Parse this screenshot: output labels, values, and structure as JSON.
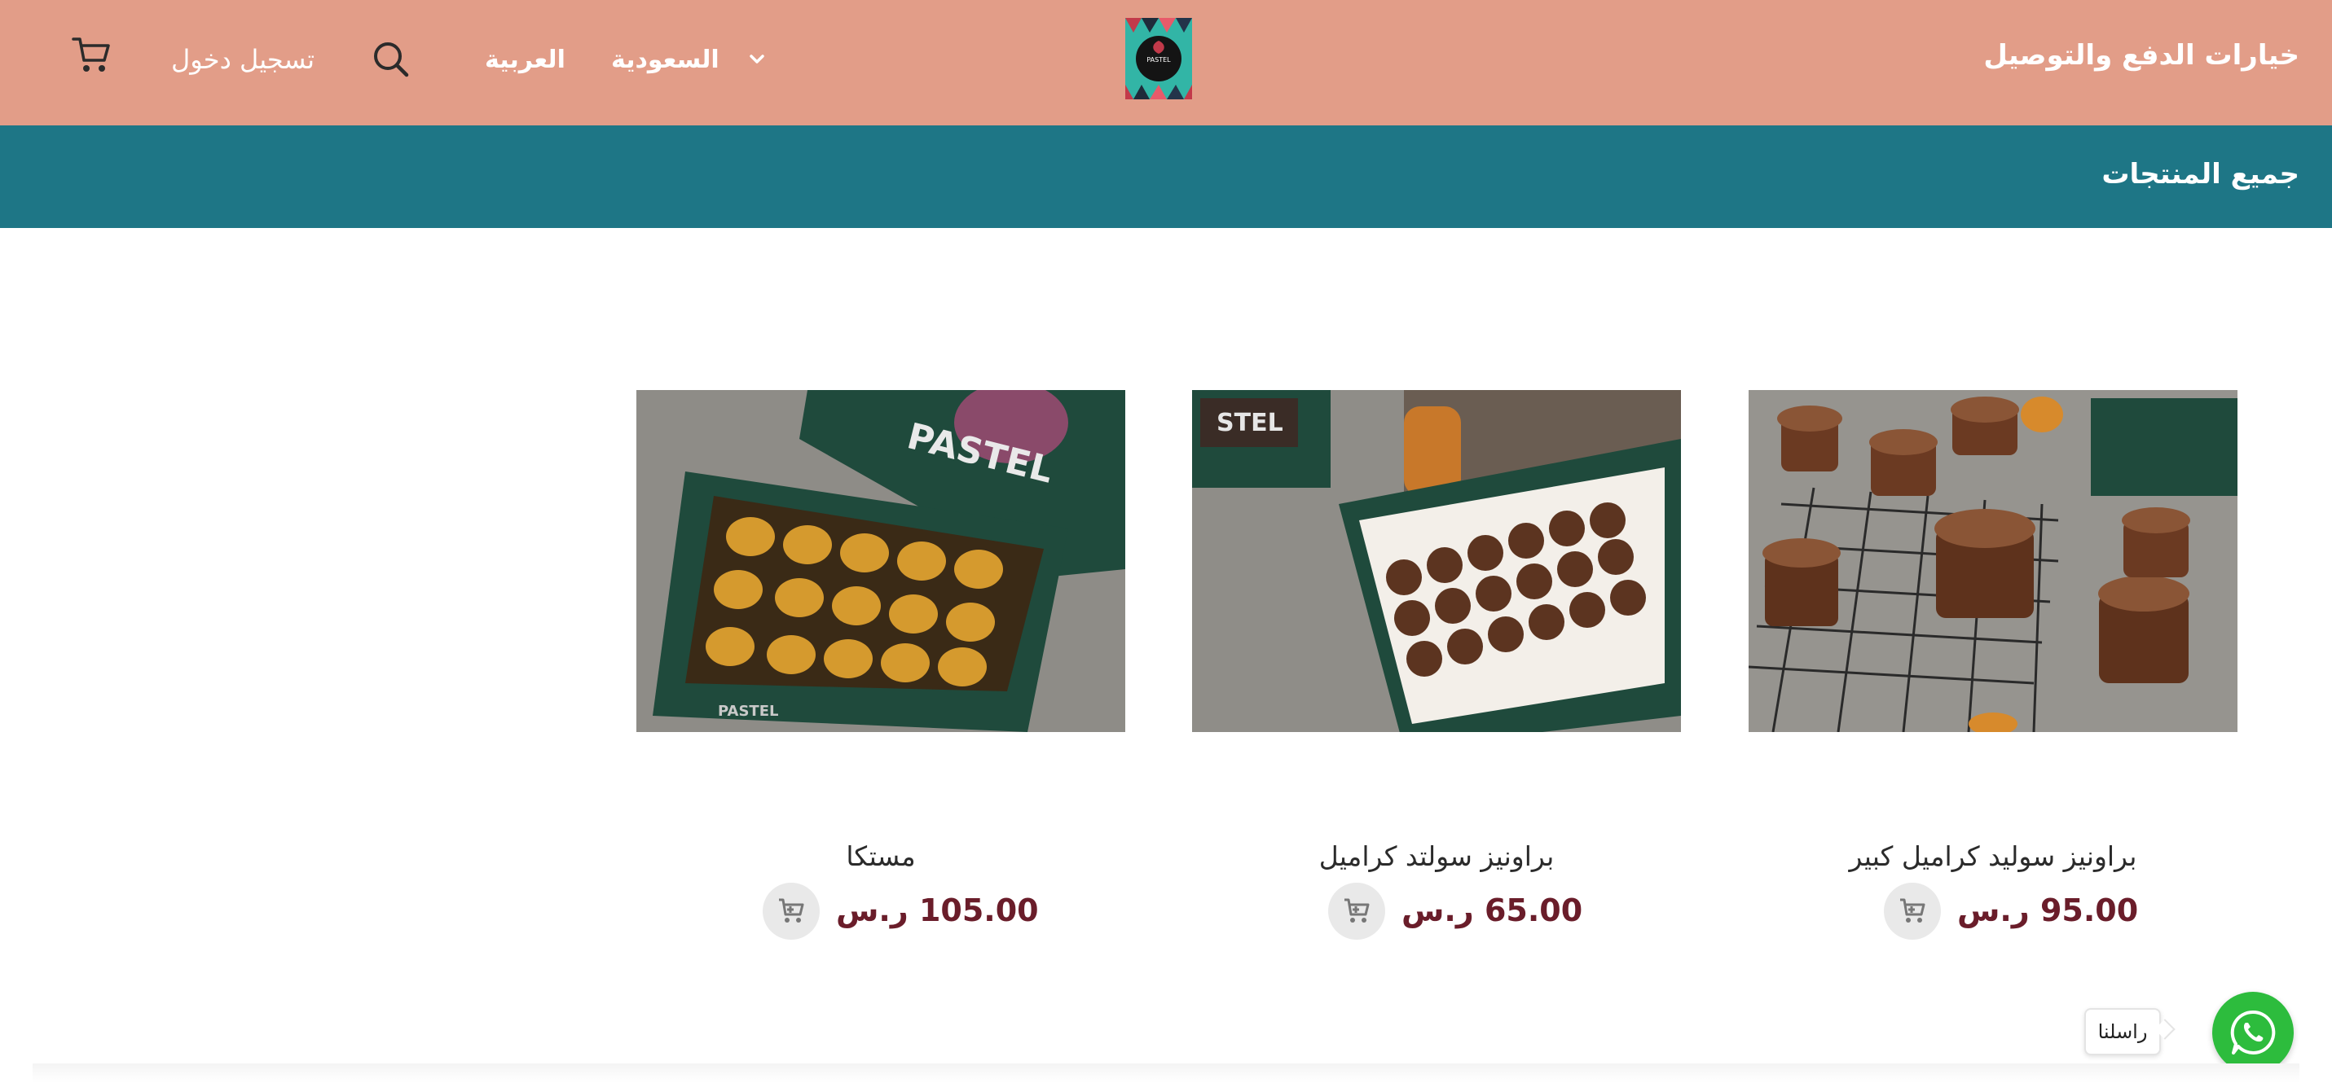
{
  "header": {
    "right_link": "خيارات الدفع والتوصيل",
    "logo_text": "PASTEL",
    "country": "السعودية",
    "language": "العربية",
    "login": "تسجيل دخول",
    "icons": [
      "chevron-down-icon",
      "search-icon",
      "cart-icon"
    ]
  },
  "category_bar": {
    "title": "جميع المنتجات"
  },
  "products": [
    {
      "name": "براونيز سوليد كراميل كبير",
      "price": "95.00 ر.س"
    },
    {
      "name": "براونيز سولتد كراميل",
      "price": "65.00 ر.س"
    },
    {
      "name": "مستكا",
      "price": "105.00 ر.س"
    }
  ],
  "chat": {
    "label": "راسلنا",
    "icon": "whatsapp-icon"
  },
  "colors": {
    "header_bg": "#e29d88",
    "category_bg": "#1e7686",
    "price": "#6a1d2a",
    "whatsapp": "#2dbc3d",
    "box_green": "#1f4a3c"
  }
}
